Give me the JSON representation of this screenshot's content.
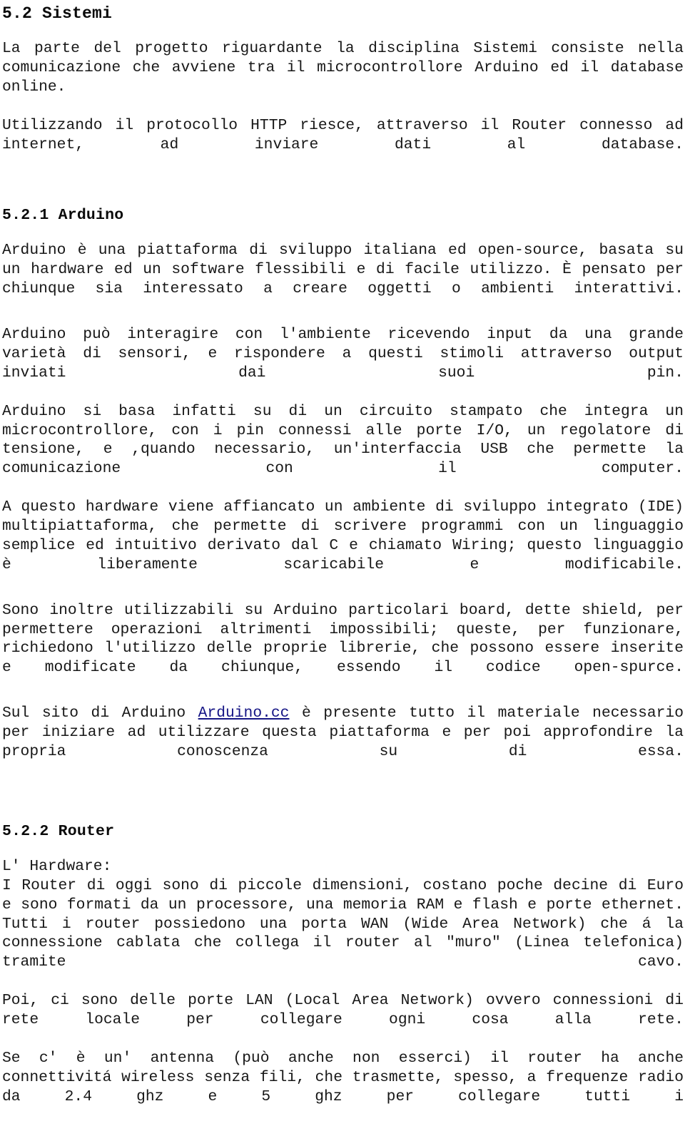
{
  "document": {
    "language": "it",
    "page_background": "#ffffff",
    "text_color": "#171717",
    "link_color": "#151585"
  },
  "sections": {
    "sistemi": {
      "heading": "5.2 Sistemi",
      "paragraph_1": "La parte del progetto riguardante la disciplina Sistemi consiste nella comunicazione che avviene tra il microcontrollore Arduino ed il database online.",
      "paragraph_2": "Utilizzando il protocollo HTTP riesce, attraverso il Router connesso ad internet, ad inviare dati al database."
    },
    "arduino": {
      "heading": "5.2.1 Arduino",
      "paragraph_1": "Arduino è una piattaforma di sviluppo italiana ed open-source, basata su un hardware ed un software flessibili e di facile utilizzo. È pensato per chiunque sia interessato a creare oggetti o ambienti interattivi.",
      "paragraph_2": "Arduino può interagire con l'ambiente ricevendo input da una grande varietà di sensori, e rispondere a questi stimoli attraverso output inviati dai suoi pin.",
      "paragraph_3": "Arduino si basa infatti su di un circuito stampato che integra un microcontrollore, con i pin connessi alle porte I/O, un regolatore di tensione, e ,quando necessario, un'interfaccia USB che permette la comunicazione con il computer.",
      "paragraph_4": "A questo hardware viene affiancato un ambiente di sviluppo integrato (IDE) multipiattaforma, che permette di scrivere programmi con un linguaggio semplice ed intuitivo derivato dal C e chiamato Wiring; questo linguaggio è liberamente scaricabile e modificabile.",
      "paragraph_5": "Sono inoltre utilizzabili su Arduino particolari board, dette shield, per permettere operazioni altrimenti impossibili; queste, per funzionare, richiedono l'utilizzo delle proprie librerie, che possono essere inserite e modificate da chiunque, essendo il codice open-spurce.",
      "paragraph_6_before_link": "Sul sito di Arduino ",
      "link_text": "Arduino.cc",
      "paragraph_6_after_link": " è presente tutto il materiale necessario per iniziare ad utilizzare questa piattaforma e per poi approfondire la propria conoscenza su di essa."
    },
    "router": {
      "heading": "5.2.2 Router",
      "subheading": "L' Hardware:",
      "paragraph_1": "I Router di oggi sono di piccole dimensioni, costano poche decine di Euro e sono formati da un processore, una memoria RAM e flash e porte ethernet. Tutti i router possiedono una porta WAN (Wide Area Network) che á la connessione cablata che collega il router al \"muro\" (Linea telefonica) tramite cavo.",
      "paragraph_2": "Poi, ci sono delle porte LAN (Local Area Network) ovvero connessioni di rete locale per collegare ogni cosa alla rete.",
      "paragraph_3": "Se c' è un' antenna (può anche non esserci) il router ha anche connettivitá wireless senza fili, che trasmette, spesso, a frequenze radio da 2.4 ghz e 5 ghz per collegare tutti i"
    }
  }
}
